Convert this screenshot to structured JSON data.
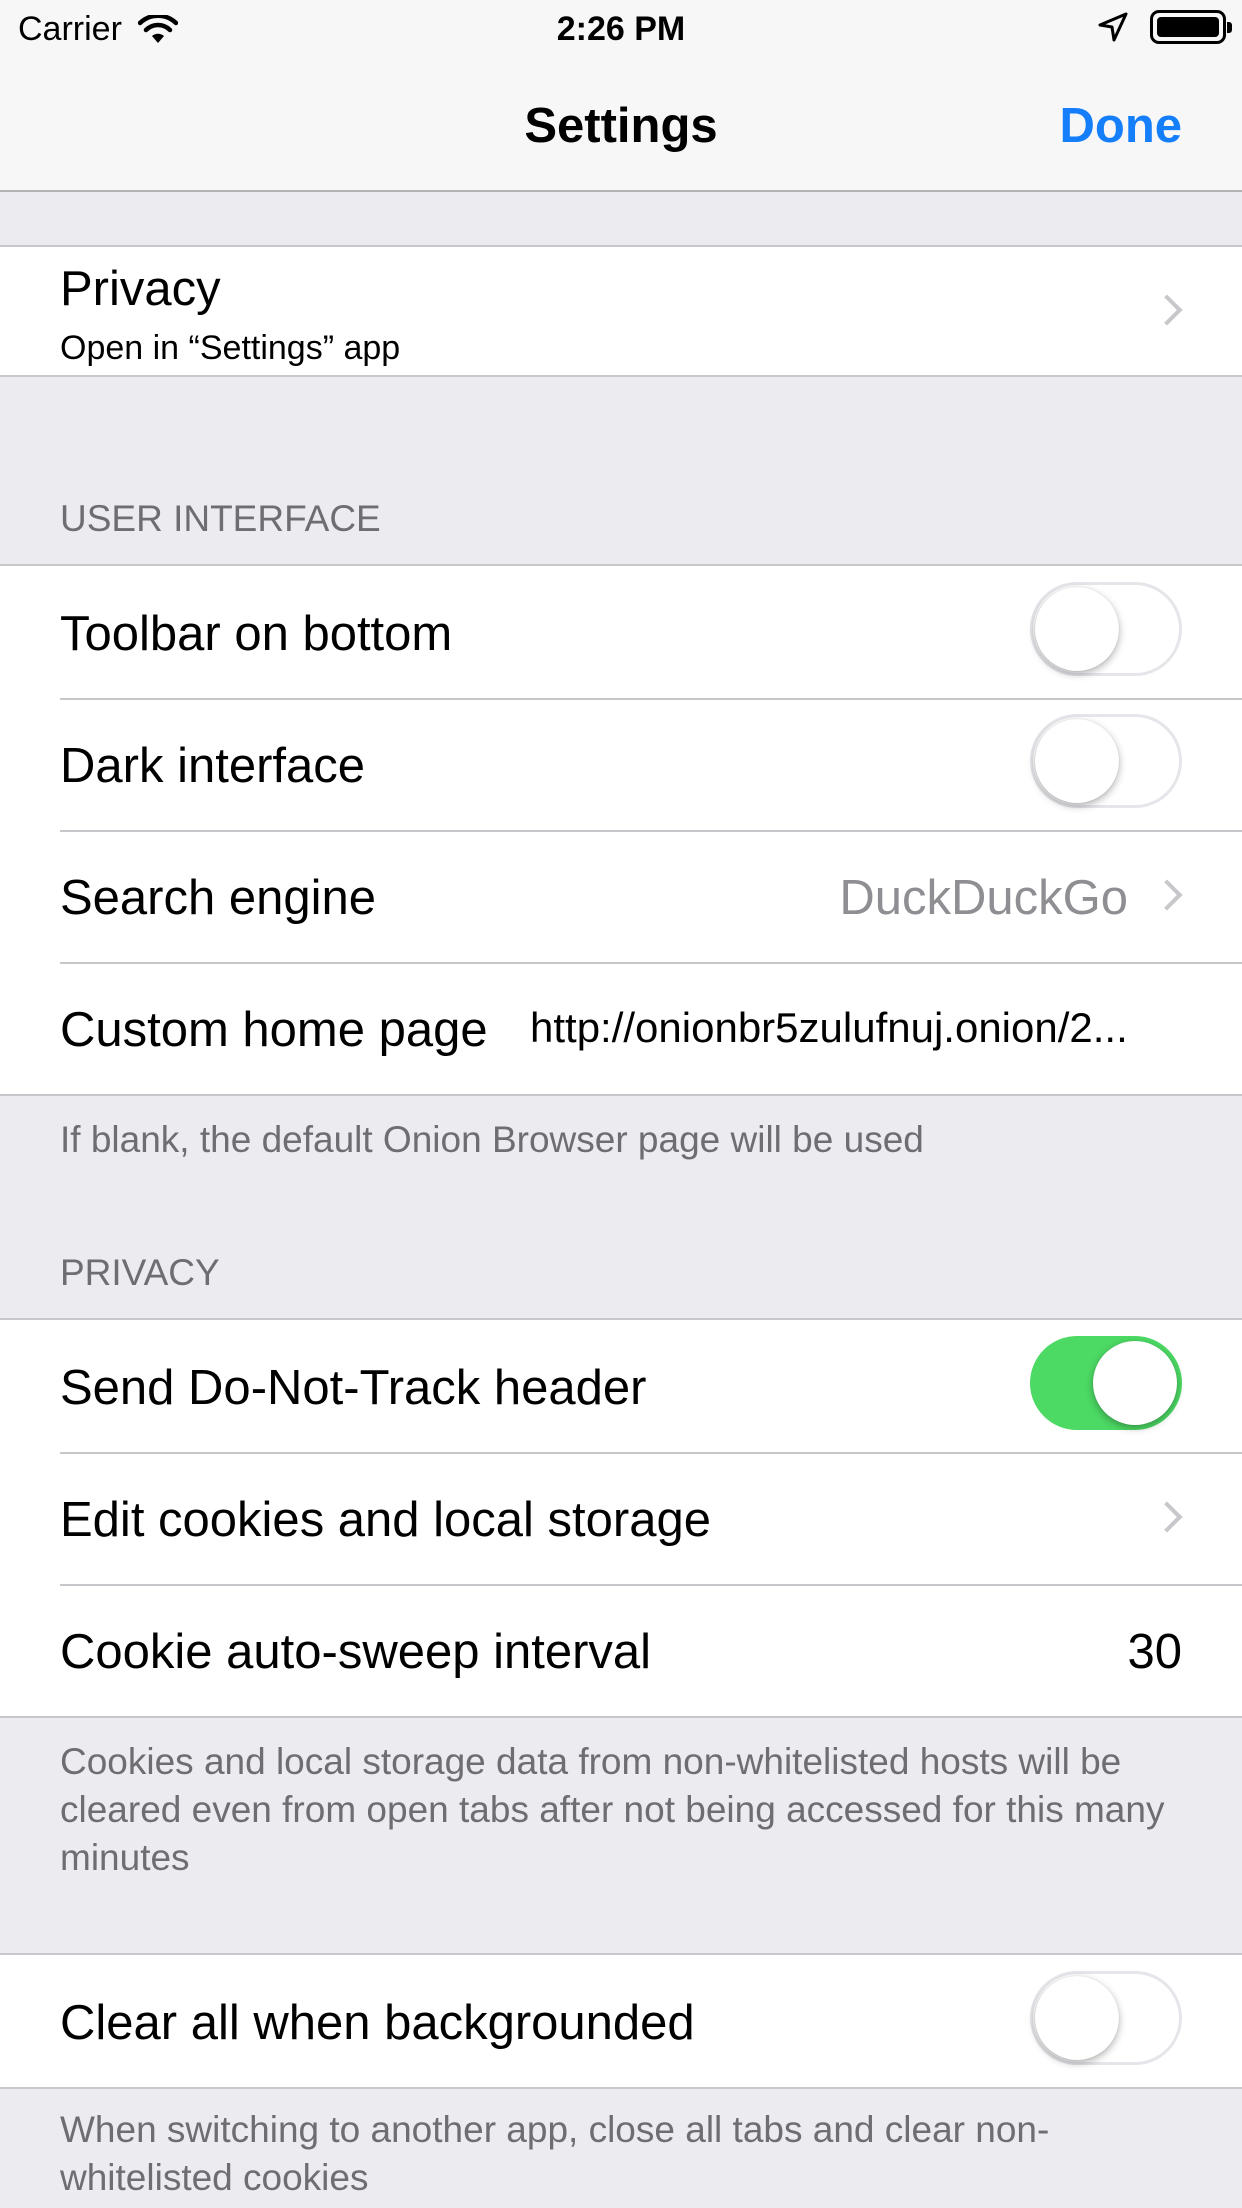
{
  "status_bar": {
    "carrier": "Carrier",
    "time": "2:26 PM"
  },
  "nav": {
    "title": "Settings",
    "done_label": "Done"
  },
  "privacy_link": {
    "title": "Privacy",
    "subtitle": "Open in “Settings” app"
  },
  "user_interface": {
    "header": "USER INTERFACE",
    "toolbar_on_bottom": {
      "label": "Toolbar on bottom",
      "on": false
    },
    "dark_interface": {
      "label": "Dark interface",
      "on": false
    },
    "search_engine": {
      "label": "Search engine",
      "value": "DuckDuckGo"
    },
    "custom_home_page": {
      "label": "Custom home page",
      "value": "http://onionbr5zulufnuj.onion/2..."
    },
    "footer": "If blank, the default Onion Browser page will be used"
  },
  "privacy": {
    "header": "PRIVACY",
    "do_not_track": {
      "label": "Send Do-Not-Track header",
      "on": true
    },
    "edit_cookies": {
      "label": "Edit cookies and local storage"
    },
    "auto_sweep": {
      "label": "Cookie auto-sweep interval",
      "value": "30"
    },
    "footer": "Cookies and local storage data from non-whitelisted hosts will be cleared even from open tabs after not being accessed for this many minutes"
  },
  "backgrounding": {
    "clear_all": {
      "label": "Clear all when backgrounded",
      "on": false
    },
    "footer": "When switching to another app, close all tabs and clear non-whitelisted cookies"
  },
  "colors": {
    "accent": "#157efb",
    "toggle_on": "#4cd964",
    "background": "#ebebf0",
    "secondary_text": "#6d6d72"
  }
}
